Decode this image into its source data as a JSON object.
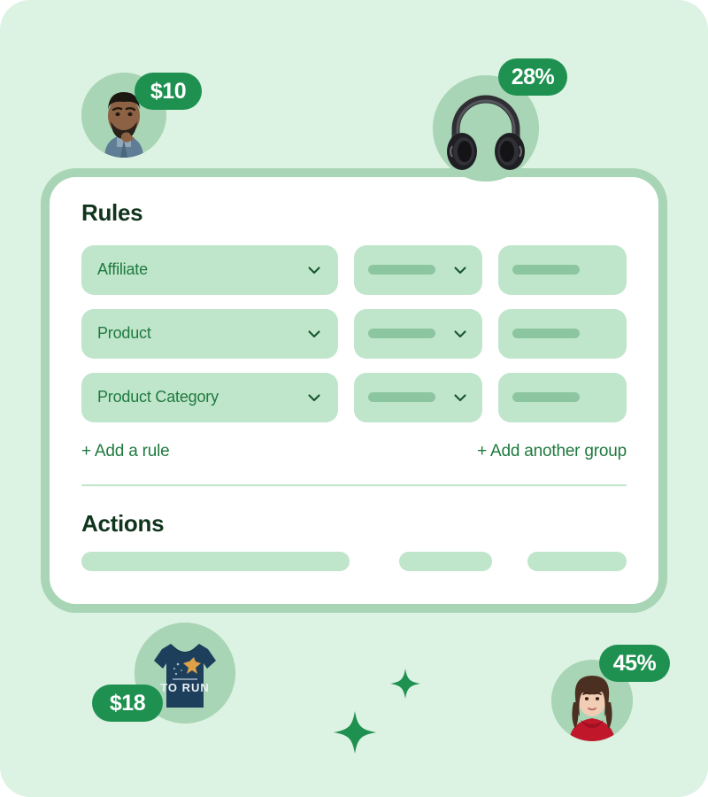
{
  "card": {
    "rules_title": "Rules",
    "actions_title": "Actions",
    "rule_rows": [
      {
        "label": "Affiliate"
      },
      {
        "label": "Product"
      },
      {
        "label": "Product Category"
      }
    ],
    "add_rule_label": "+ Add a rule",
    "add_group_label": "+ Add another group"
  },
  "decorations": {
    "avatar_man_badge": "$10",
    "headphones_badge": "28%",
    "shirt_badge": "$18",
    "avatar_woman_badge": "45%",
    "shirt_graphic_text": "TO RUN"
  },
  "colors": {
    "page_background": "#dcf2e2",
    "card_background": "#ffffff",
    "card_border": "#a8d5b5",
    "field_background": "#bfe5cb",
    "skeleton_bar": "#8cc6a1",
    "accent_green": "#1f7a3f",
    "badge_green": "#1e9150",
    "title_green": "#10341c"
  }
}
